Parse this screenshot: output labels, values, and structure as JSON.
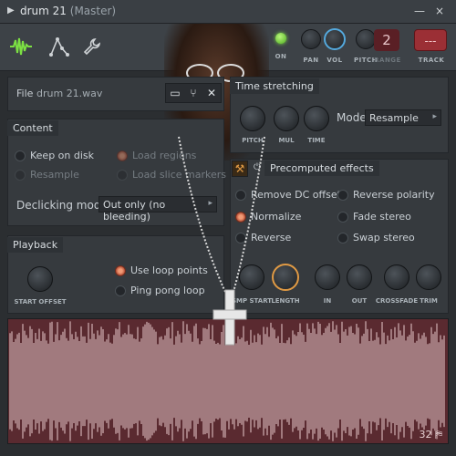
{
  "window": {
    "title": "drum 21",
    "subtitle": "(Master)",
    "minimize_glyph": "—",
    "close_glyph": "×"
  },
  "toolbar": {
    "tools": [
      "waveform-icon",
      "envelope-icon",
      "wrench-icon"
    ],
    "on_label": "ON",
    "pan_label": "PAN",
    "vol_label": "VOL",
    "pitch_label": "PITCH",
    "range_label": "RANGE",
    "range_value": "2",
    "track_label": "TRACK",
    "track_value": "---",
    "led_color": "#7ce043",
    "accent": "#54a9dd"
  },
  "file": {
    "label": "File",
    "name": "drum 21.wav"
  },
  "time_stretching": {
    "title": "Time stretching",
    "knobs": [
      "PITCH",
      "MUL",
      "TIME"
    ],
    "mode_label": "Mode",
    "mode_value": "Resample"
  },
  "content": {
    "title": "Content",
    "options": [
      {
        "label": "Keep on disk",
        "on": false,
        "dim": false
      },
      {
        "label": "Load regions",
        "on": true,
        "dim": true
      },
      {
        "label": "Resample",
        "on": false,
        "dim": true
      },
      {
        "label": "Load slice markers",
        "on": false,
        "dim": true
      }
    ],
    "declicking_label": "Declicking mode",
    "declicking_value": "Out only (no bleeding)"
  },
  "precomputed": {
    "title": "Precomputed effects",
    "options": [
      {
        "label": "Remove DC offset",
        "on": false
      },
      {
        "label": "Reverse polarity",
        "on": false
      },
      {
        "label": "Normalize",
        "on": true
      },
      {
        "label": "Fade stereo",
        "on": false
      },
      {
        "label": "Reverse",
        "on": false
      },
      {
        "label": "Swap stereo",
        "on": false
      }
    ],
    "knobs": [
      "SMP START",
      "LENGTH",
      "IN",
      "OUT",
      "CROSSFADE",
      "TRIM"
    ]
  },
  "playback": {
    "title": "Playback",
    "start_offset_label": "START OFFSET",
    "options": [
      {
        "label": "Use loop points",
        "on": true
      },
      {
        "label": "Ping pong loop",
        "on": false
      }
    ]
  },
  "waveform": {
    "number": "32",
    "color": "#e8c9cc"
  }
}
